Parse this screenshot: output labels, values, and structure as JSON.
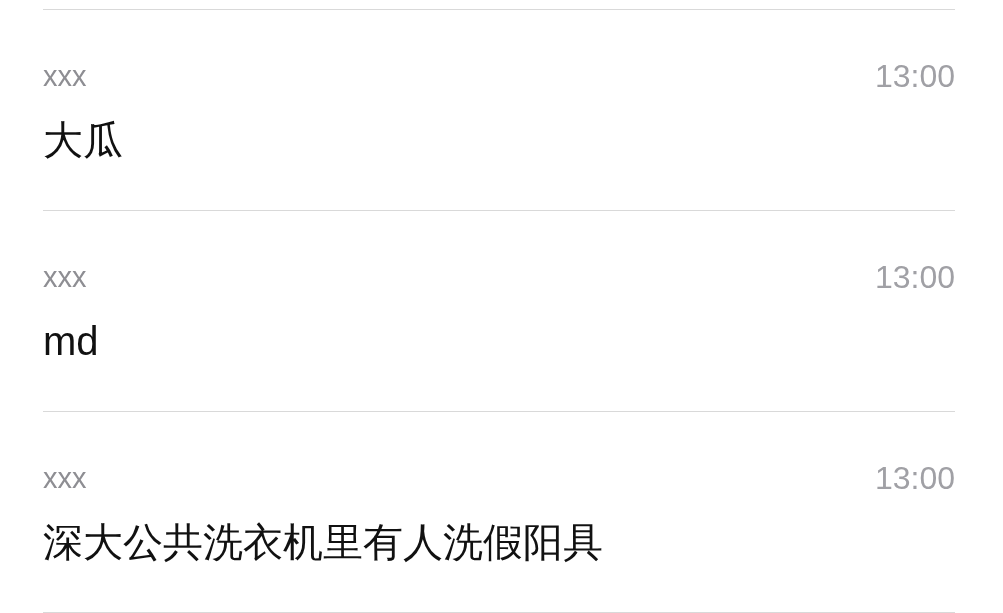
{
  "messages": [
    {
      "sender": "xxx",
      "time": "13:00",
      "text": "大瓜"
    },
    {
      "sender": "xxx",
      "time": "13:00",
      "text": "md"
    },
    {
      "sender": "xxx",
      "time": "13:00",
      "text": "深大公共洗衣机里有人洗假阳具"
    }
  ]
}
